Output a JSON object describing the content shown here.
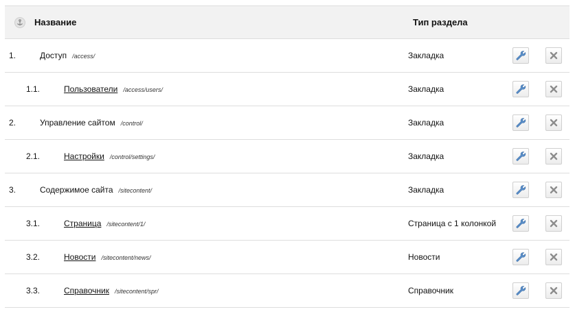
{
  "header": {
    "name_label": "Название",
    "type_label": "Тип раздела"
  },
  "rows": [
    {
      "num": "1.",
      "name": "Доступ",
      "path": "/access/",
      "type": "Закладка",
      "level": 0
    },
    {
      "num": "1.1.",
      "name": "Пользователи",
      "path": "/access/users/",
      "type": "Закладка",
      "level": 1
    },
    {
      "num": "2.",
      "name": "Управление сайтом",
      "path": "/control/",
      "type": "Закладка",
      "level": 0
    },
    {
      "num": "2.1.",
      "name": "Настройки",
      "path": "/control/settings/",
      "type": "Закладка",
      "level": 1
    },
    {
      "num": "3.",
      "name": "Содержимое сайта",
      "path": "/sitecontent/",
      "type": "Закладка",
      "level": 0
    },
    {
      "num": "3.1.",
      "name": "Страница",
      "path": "/sitecontent/1/",
      "type": "Страница с 1 колонкой",
      "level": 1
    },
    {
      "num": "3.2.",
      "name": "Новости",
      "path": "/sitecontent/news/",
      "type": "Новости",
      "level": 1
    },
    {
      "num": "3.3.",
      "name": "Справочник",
      "path": "/sitecontent/spr/",
      "type": "Справочник",
      "level": 1
    }
  ],
  "icons": {
    "sort": "anchor-icon",
    "edit": "wrench-icon",
    "delete": "close-icon"
  },
  "colors": {
    "header_bg": "#f2f2f2",
    "row_border": "#dddddd",
    "edit_icon": "#5b8fc9",
    "delete_icon": "#8c8c8c"
  }
}
